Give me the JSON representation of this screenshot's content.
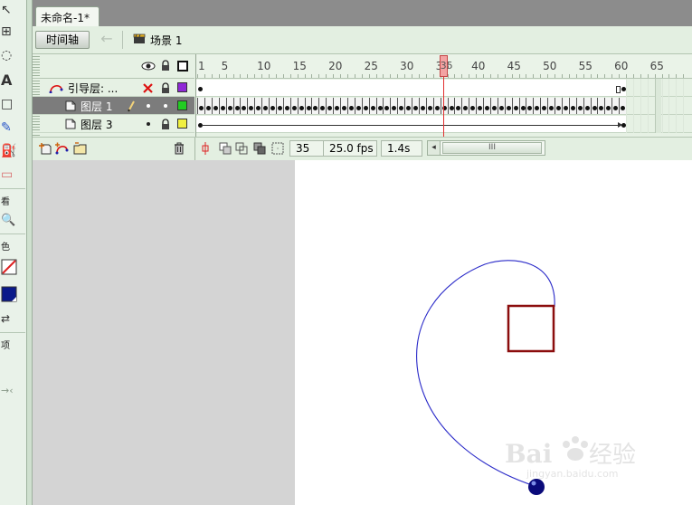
{
  "document_tab": {
    "title": "未命名-1*"
  },
  "toolbar": {
    "timeline_button": "时间轴",
    "back_arrow": "←",
    "scene_label": "场景 1"
  },
  "tools": {
    "items": [
      {
        "name": "selection-tool-icon",
        "glyph": "↖"
      },
      {
        "name": "free-transform-tool-icon",
        "glyph": "⊞"
      },
      {
        "name": "lasso-tool-icon",
        "glyph": "◌"
      },
      {
        "name": "text-tool-icon",
        "glyph": "A"
      },
      {
        "name": "rectangle-tool-icon",
        "glyph": "□"
      },
      {
        "name": "brush-tool-icon",
        "glyph": "✎"
      },
      {
        "name": "paint-bucket-tool-icon",
        "glyph": "⛽"
      },
      {
        "name": "eraser-tool-icon",
        "glyph": "▭"
      }
    ],
    "section_view": "看",
    "section_color": "色",
    "section_options": "项",
    "zoom_icon": "🔍",
    "swap_icon": "⇄",
    "snap_icon": "→‹"
  },
  "layers": {
    "header_icons": [
      "eye-icon",
      "lock-icon",
      "outline-icon"
    ],
    "rows": [
      {
        "name": "引导层: ...",
        "color": "#8f28d6",
        "type": "guide"
      },
      {
        "name": "图层 1",
        "color": "#22cc22",
        "type": "normal",
        "selected": true
      },
      {
        "name": "图层 3",
        "color": "#f0f040",
        "type": "normal"
      }
    ]
  },
  "ruler": {
    "labels": [
      "1",
      "5",
      "10",
      "15",
      "20",
      "25",
      "30",
      "35",
      "40",
      "45",
      "50",
      "55",
      "60",
      "65"
    ]
  },
  "playhead": {
    "frame": "35"
  },
  "status": {
    "current_frame": "35",
    "fps": "25.0 fps",
    "elapsed": "1.4s",
    "scroll_thumb": "III"
  },
  "stage": {
    "path_color": "#2929c8",
    "square_color": "#8b0d0d",
    "ball_color": "#0a0a7a"
  },
  "watermark": {
    "text": "Baidu经验",
    "subtext": "jingyan.baidu.com"
  }
}
